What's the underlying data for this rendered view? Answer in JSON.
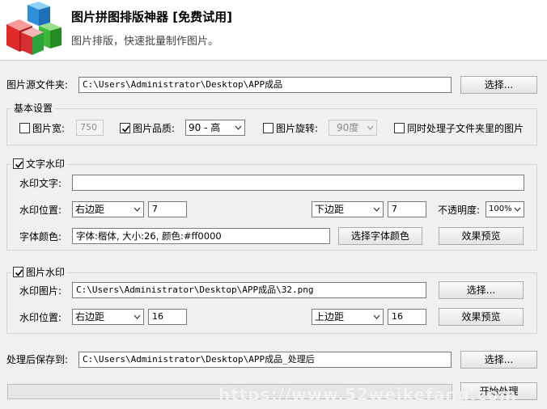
{
  "header": {
    "title": "图片拼图排版神器 [免费试用]",
    "subtitle": "图片排版，快速批量制作图片。"
  },
  "source": {
    "label": "图片源文件夹:",
    "path": "C:\\Users\\Administrator\\Desktop\\APP成品",
    "browse_label": "选择..."
  },
  "basic": {
    "title": "基本设置",
    "width_label": "图片宽:",
    "width_checked": false,
    "width_value": "750",
    "quality_label": "图片品质:",
    "quality_checked": true,
    "quality_value": "90 - 高",
    "rotate_label": "图片旋转:",
    "rotate_checked": false,
    "rotate_value": "90度",
    "subfolder_label": "同时处理子文件夹里的图片",
    "subfolder_checked": false
  },
  "text_wm": {
    "title": "文字水印",
    "checked": true,
    "text_label": "水印文字:",
    "text_value": "",
    "position_label": "水印位置:",
    "h_side": "右边距",
    "h_value": "7",
    "v_side": "下边距",
    "v_value": "7",
    "opacity_label": "不透明度:",
    "opacity_value": "100%",
    "font_label": "字体颜色:",
    "font_value": "字体:楷体, 大小:26, 颜色:#ff0000",
    "font_button": "选择字体颜色",
    "preview_button": "效果预览"
  },
  "image_wm": {
    "title": "图片水印",
    "checked": true,
    "image_label": "水印图片:",
    "image_path": "C:\\Users\\Administrator\\Desktop\\APP成品\\32.png",
    "browse_label": "选择...",
    "position_label": "水印位置:",
    "h_side": "右边距",
    "h_value": "16",
    "v_side": "上边距",
    "v_value": "16",
    "preview_button": "效果预览"
  },
  "output": {
    "label": "处理后保存到:",
    "path": "C:\\Users\\Administrator\\Desktop\\APP成品_处理后",
    "browse_label": "选择..."
  },
  "actions": {
    "start_label": "开始处理",
    "progress": 0
  },
  "watermark": "https://www.52weikefang.com"
}
